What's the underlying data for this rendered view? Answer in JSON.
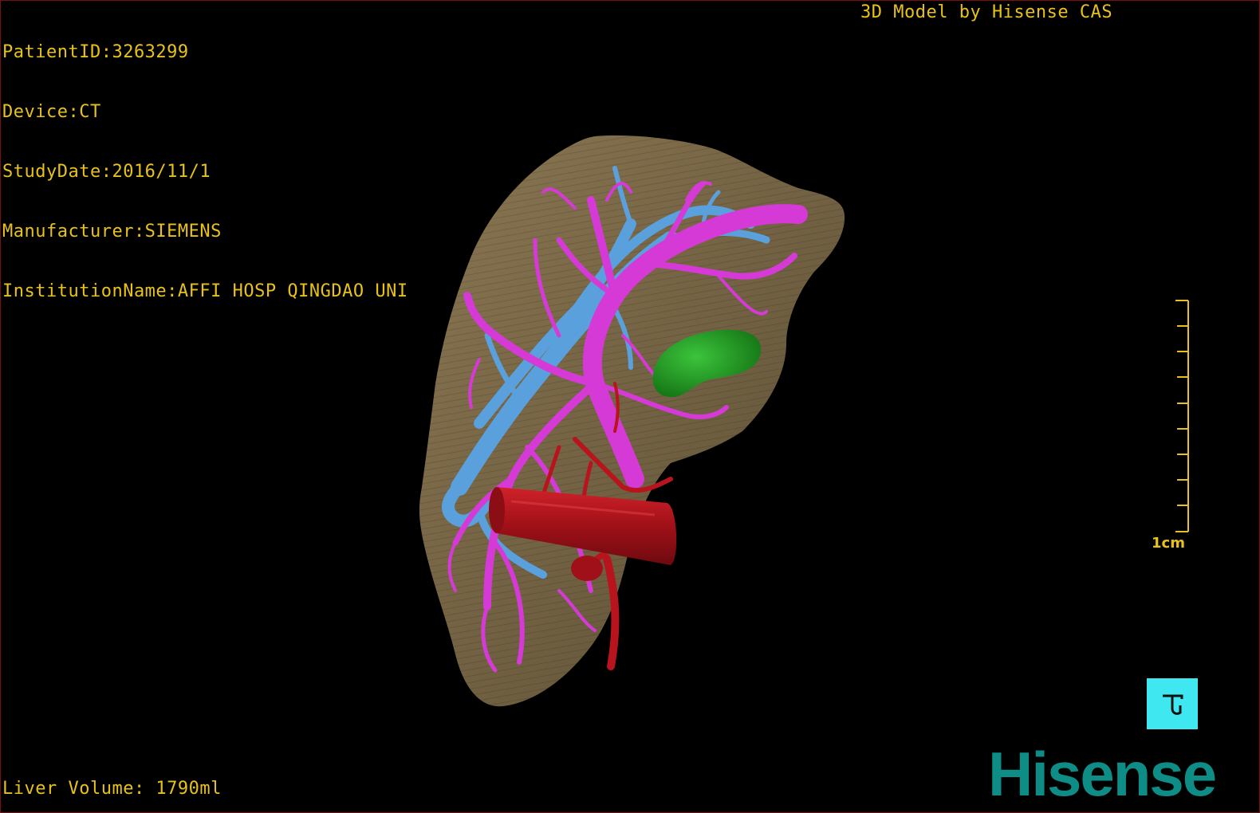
{
  "dicom": {
    "patient_id": "PatientID:3263299",
    "device": "Device:CT",
    "study_date": "StudyDate:2016/11/1",
    "manufacturer": "Manufacturer:SIEMENS",
    "institution": "InstitutionName:AFFI HOSP QINGDAO UNI"
  },
  "credit": "3D Model by Hisense CAS",
  "liver_volume": "Liver Volume: 1790ml",
  "scale_bar": {
    "label": "1cm"
  },
  "view_button": {
    "icon": "orientation-cube-icon"
  },
  "logo": "Hisense",
  "colors": {
    "overlay_text": "#e8c21a",
    "liver": "#7a6a4a",
    "hepatic_vein": "#d63ad6",
    "portal_vein": "#5aa0dc",
    "artery_ivc": "#b8141e",
    "tumor": "#1f9a1f",
    "view_button": "#3fe8f0",
    "logo": "#0e8d86"
  }
}
